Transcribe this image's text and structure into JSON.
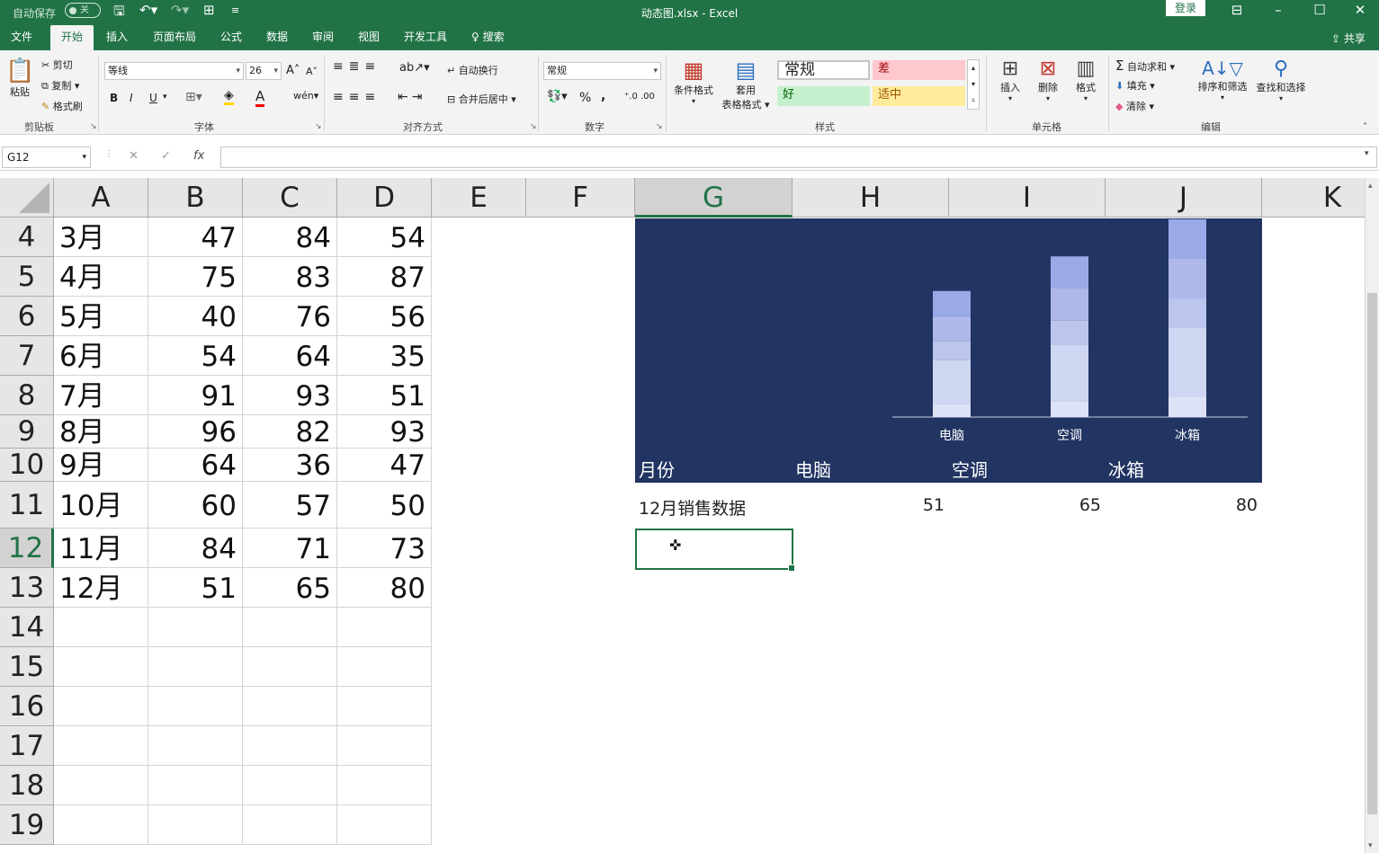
{
  "titlebar": {
    "autosave_label": "自动保存",
    "autosave_state": "关",
    "title": "动态图.xlsx  -  Excel",
    "login": "登录"
  },
  "tabs": {
    "items": [
      "文件",
      "开始",
      "插入",
      "页面布局",
      "公式",
      "数据",
      "审阅",
      "视图",
      "开发工具"
    ],
    "active": "开始",
    "search": "搜索",
    "share": "共享"
  },
  "ribbon": {
    "clipboard": {
      "paste": "粘贴",
      "cut": "剪切",
      "copy": "复制",
      "format_painter": "格式刷",
      "group": "剪贴板"
    },
    "font": {
      "name": "等线",
      "size": "26",
      "bold": "B",
      "italic": "I",
      "underline": "U",
      "group": "字体"
    },
    "alignment": {
      "wrap": "自动换行",
      "merge": "合并后居中",
      "group": "对齐方式"
    },
    "number": {
      "format": "常规",
      "percent": "%",
      "comma": ",",
      "group": "数字"
    },
    "styles": {
      "conditional": "条件格式",
      "table1": "套用",
      "table2": "表格格式",
      "normal": "常规",
      "bad": "差",
      "good": "好",
      "neutral": "适中",
      "group": "样式"
    },
    "cells": {
      "insert": "插入",
      "delete": "删除",
      "format": "格式",
      "group": "单元格"
    },
    "editing": {
      "autosum": "自动求和",
      "fill": "填充",
      "clear": "清除",
      "sort": "排序和筛选",
      "find": "查找和选择",
      "group": "编辑"
    }
  },
  "formula_bar": {
    "namebox": "G12",
    "formula": ""
  },
  "columns": [
    "A",
    "B",
    "C",
    "D",
    "E",
    "F",
    "G",
    "H",
    "I",
    "J",
    "K"
  ],
  "selected_column": "G",
  "selected_row": "12",
  "rows": [
    {
      "n": "4",
      "cells": [
        "3月",
        "47",
        "84",
        "54"
      ]
    },
    {
      "n": "5",
      "cells": [
        "4月",
        "75",
        "83",
        "87"
      ]
    },
    {
      "n": "6",
      "cells": [
        "5月",
        "40",
        "76",
        "56"
      ]
    },
    {
      "n": "7",
      "cells": [
        "6月",
        "54",
        "64",
        "35"
      ]
    },
    {
      "n": "8",
      "cells": [
        "7月",
        "91",
        "93",
        "51"
      ]
    },
    {
      "n": "9",
      "cells": [
        "8月",
        "96",
        "82",
        "93"
      ]
    },
    {
      "n": "10",
      "cells": [
        "9月",
        "64",
        "36",
        "47"
      ]
    },
    {
      "n": "11",
      "cells": [
        "10月",
        "60",
        "57",
        "50"
      ]
    },
    {
      "n": "12",
      "cells": [
        "11月",
        "84",
        "71",
        "73"
      ]
    },
    {
      "n": "13",
      "cells": [
        "12月",
        "51",
        "65",
        "80"
      ]
    },
    {
      "n": "14",
      "cells": []
    },
    {
      "n": "15",
      "cells": []
    },
    {
      "n": "16",
      "cells": []
    },
    {
      "n": "17",
      "cells": []
    },
    {
      "n": "18",
      "cells": []
    },
    {
      "n": "19",
      "cells": []
    }
  ],
  "summary": {
    "label": "12月销售数据",
    "values": [
      "51",
      "65",
      "80"
    ]
  },
  "chart_header": [
    "月份",
    "电脑",
    "空调",
    "冰箱"
  ],
  "colors": {
    "excel_green": "#217346",
    "chart_bg": "#213462",
    "bar_light": "#d2d8f2",
    "bar_dark": "#9aa9e8"
  },
  "chart_data": {
    "type": "bar",
    "categories": [
      "电脑",
      "空调",
      "冰箱"
    ],
    "values": [
      51,
      65,
      80
    ],
    "ylim": [
      0,
      80
    ],
    "grid": false,
    "legend": "none"
  }
}
